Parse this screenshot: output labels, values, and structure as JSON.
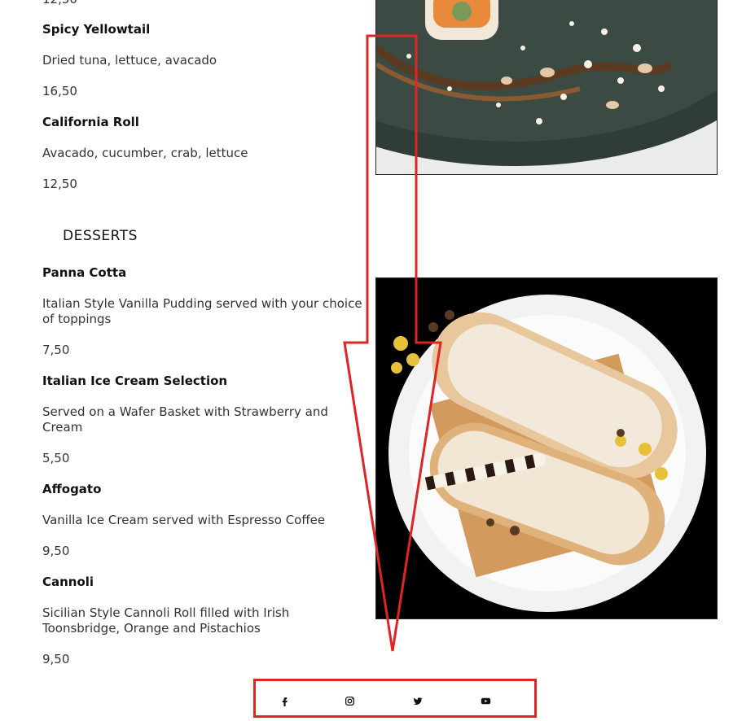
{
  "menu": {
    "top_price": "12,50",
    "items_top": [
      {
        "name": "Spicy Yellowtail",
        "desc": "Dried tuna, lettuce, avacado",
        "price": "16,50"
      },
      {
        "name": "California Roll",
        "desc": "Avacado, cucumber, crab, lettuce",
        "price": "12,50"
      }
    ],
    "desserts_title": "DESSERTS",
    "desserts": [
      {
        "name": "Panna Cotta",
        "desc": "Italian Style Vanilla Pudding served with your choice of toppings",
        "price": "7,50"
      },
      {
        "name": "Italian Ice Cream Selection",
        "desc": "Served on a Wafer Basket with Strawberry and Cream",
        "price": "5,50"
      },
      {
        "name": "Affogato",
        "desc": "Vanilla Ice Cream served with Espresso Coffee",
        "price": "9,50"
      },
      {
        "name": "Cannoli",
        "desc": "Sicilian Style Cannoli Roll filled with Irish Toonsbridge, Orange and Pistachios",
        "price": "9,50"
      }
    ]
  },
  "images": {
    "sushi": "sushi-roll-photo",
    "cannoli": "cannoli-dessert-photo"
  },
  "social": [
    {
      "icon": "facebook-icon"
    },
    {
      "icon": "instagram-icon"
    },
    {
      "icon": "twitter-icon"
    },
    {
      "icon": "youtube-icon"
    }
  ],
  "annotation_color": "#e02424"
}
